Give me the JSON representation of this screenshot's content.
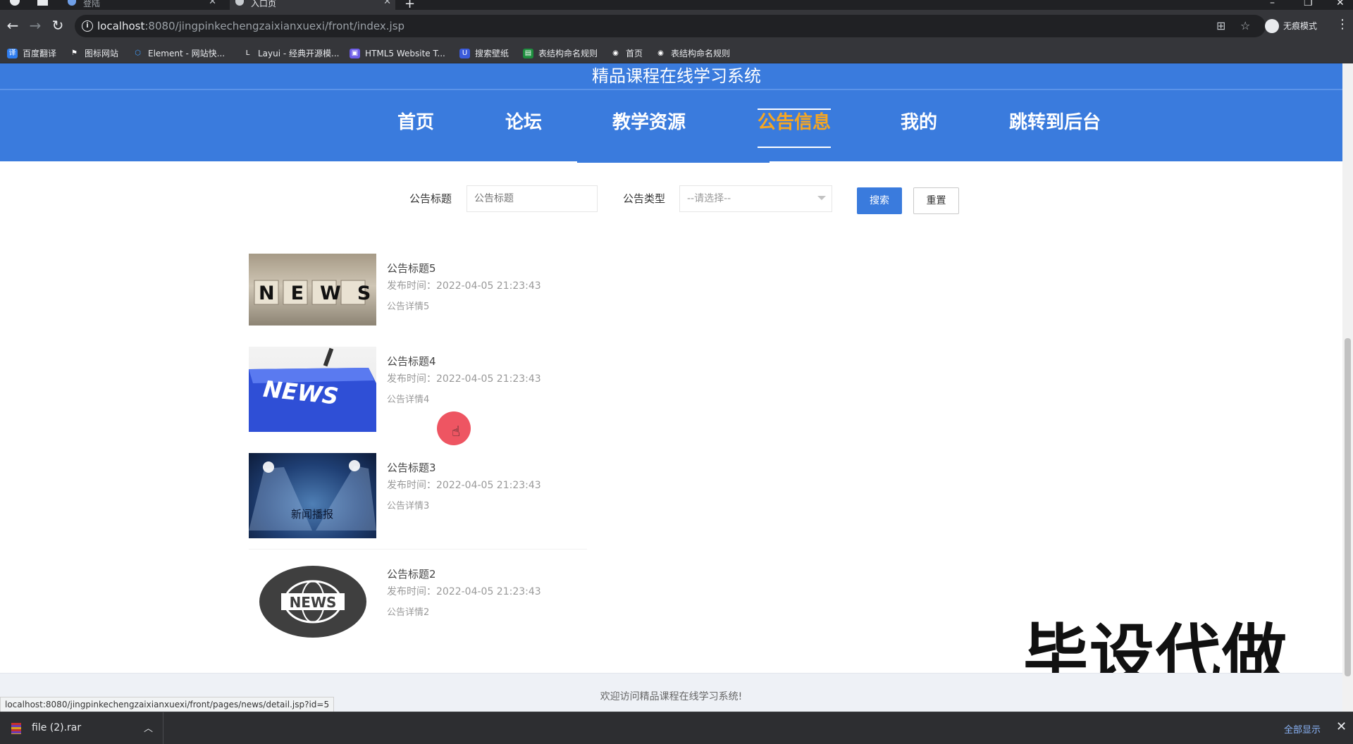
{
  "browser": {
    "tabs": [
      {
        "label": "登陆"
      },
      {
        "label": "入口页"
      }
    ],
    "url_host": "localhost",
    "url_rest": ":8080/jingpinkechengzaixianxuexi/front/index.jsp",
    "profile_label": "无痕模式"
  },
  "bookmarks": [
    {
      "label": "百度翻译",
      "icon": "baidu-translate-icon",
      "color": "#2f7dee",
      "glyph": "译"
    },
    {
      "label": "图标网站",
      "icon": "flag-icon",
      "color": "#35363a",
      "glyph": "⚑"
    },
    {
      "label": "Element - 网站快...",
      "icon": "element-icon",
      "color": "#409eff",
      "glyph": "⬡"
    },
    {
      "label": "Layui - 经典开源模...",
      "icon": "layui-icon",
      "color": "#35363a",
      "glyph": "L"
    },
    {
      "label": "HTML5 Website T...",
      "icon": "html5-template-icon",
      "color": "#6c5ce7",
      "glyph": "▣"
    },
    {
      "label": "搜索壁纸",
      "icon": "wallpaper-icon",
      "color": "#3b5bdb",
      "glyph": "U"
    },
    {
      "label": "表结构命名规则",
      "icon": "sheet-icon",
      "color": "#1e8e3e",
      "glyph": "▤"
    },
    {
      "label": "首页",
      "icon": "globe-icon",
      "color": "#35363a",
      "glyph": "◉"
    },
    {
      "label": "表结构命名规则",
      "icon": "globe-icon",
      "color": "#35363a",
      "glyph": "◉"
    }
  ],
  "site": {
    "title": "精品课程在线学习系统",
    "nav": [
      {
        "label": "首页"
      },
      {
        "label": "论坛"
      },
      {
        "label": "教学资源"
      },
      {
        "label": "公告信息"
      },
      {
        "label": "我的"
      },
      {
        "label": "跳转到后台"
      }
    ],
    "active_nav_color": "#f5a623",
    "primary_color": "#3a7bdd"
  },
  "search": {
    "title_label": "公告标题",
    "title_placeholder": "公告标题",
    "type_label": "公告类型",
    "type_selected": "--请选择--",
    "search_button": "搜索",
    "reset_button": "重置"
  },
  "news": [
    {
      "title": "公告标题5",
      "time": "发布时间：2022-04-05 21:23:43",
      "desc": "公告详情5",
      "image": "NEWS"
    },
    {
      "title": "公告标题4",
      "time": "发布时间：2022-04-05 21:23:43",
      "desc": "公告详情4",
      "image": "NEWS"
    },
    {
      "title": "公告标题3",
      "time": "发布时间：2022-04-05 21:23:43",
      "desc": "公告详情3",
      "image": "新闻播报"
    },
    {
      "title": "公告标题2",
      "time": "发布时间：2022-04-05 21:23:43",
      "desc": "公告详情2",
      "image": "NEWS"
    }
  ],
  "watermark": "毕设代做",
  "footer": {
    "text": "欢迎访问精品课程在线学习系统!"
  },
  "status_url": "localhost:8080/jingpinkechengzaixianxuexi/front/pages/news/detail.jsp?id=5",
  "download": {
    "file_name": "file (2).rar",
    "show_all": "全部显示"
  }
}
